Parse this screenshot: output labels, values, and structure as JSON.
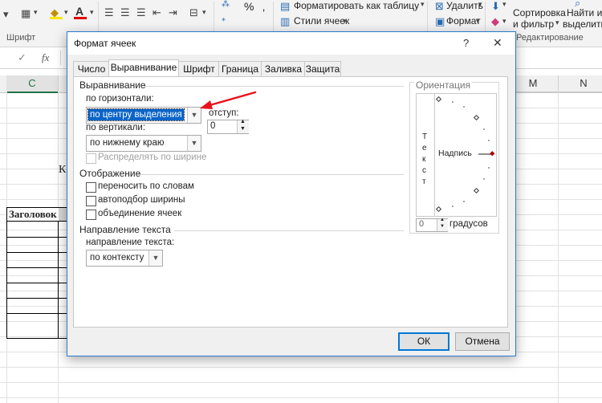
{
  "ribbon": {
    "format_as_table": "Форматировать как таблицу",
    "cell_styles": "Стили ячеек",
    "delete": "Удалить",
    "format": "Формат",
    "sort_filter_1": "Сортировка",
    "sort_filter_2": "и фильтр",
    "find_select_1": "Найти и",
    "find_select_2": "выделить",
    "group_font": "Шрифт",
    "group_editing": "Редактирование",
    "percent_symbol": "%"
  },
  "formula_bar": {
    "cancel_symbol": "✓",
    "fx_label": "fx"
  },
  "sheet": {
    "columns": [
      {
        "id": "C",
        "label": "C"
      },
      {
        "id": "M",
        "label": "M"
      },
      {
        "id": "N",
        "label": "N"
      }
    ],
    "cell_text_k": "К",
    "header_cell": "Заголовок"
  },
  "dialog": {
    "title": "Формат ячеек",
    "help_symbol": "?",
    "close_symbol": "✕",
    "tabs": [
      "Число",
      "Выравнивание",
      "Шрифт",
      "Граница",
      "Заливка",
      "Защита"
    ],
    "active_tab": "Выравнивание",
    "alignment": {
      "section_title": "Выравнивание",
      "horizontal_label": "по горизонтали:",
      "horizontal_value": "по центру выделения",
      "indent_label": "отступ:",
      "indent_value": "0",
      "vertical_label": "по вертикали:",
      "vertical_value": "по нижнему краю",
      "distributed_label": "Распределять по ширине"
    },
    "display": {
      "section_title": "Отображение",
      "wrap_text": "переносить по словам",
      "shrink_to_fit": "автоподбор ширины",
      "merge_cells": "объединение ячеек"
    },
    "text_direction": {
      "section_title": "Направление текста",
      "direction_label": "направление текста:",
      "direction_value": "по контексту"
    },
    "orientation": {
      "section_title": "Ориентация",
      "vertical_text": [
        "Т",
        "е",
        "к",
        "с",
        "т"
      ],
      "label_text": "Надпись",
      "degrees_value": "0",
      "degrees_label": "градусов"
    },
    "ok_label": "ОК",
    "cancel_label": "Отмена"
  },
  "colors": {
    "accent_blue": "#0078d7",
    "arrow_red": "#e8121b",
    "selection_blue": "#0a64c8",
    "header_green": "#217346"
  }
}
